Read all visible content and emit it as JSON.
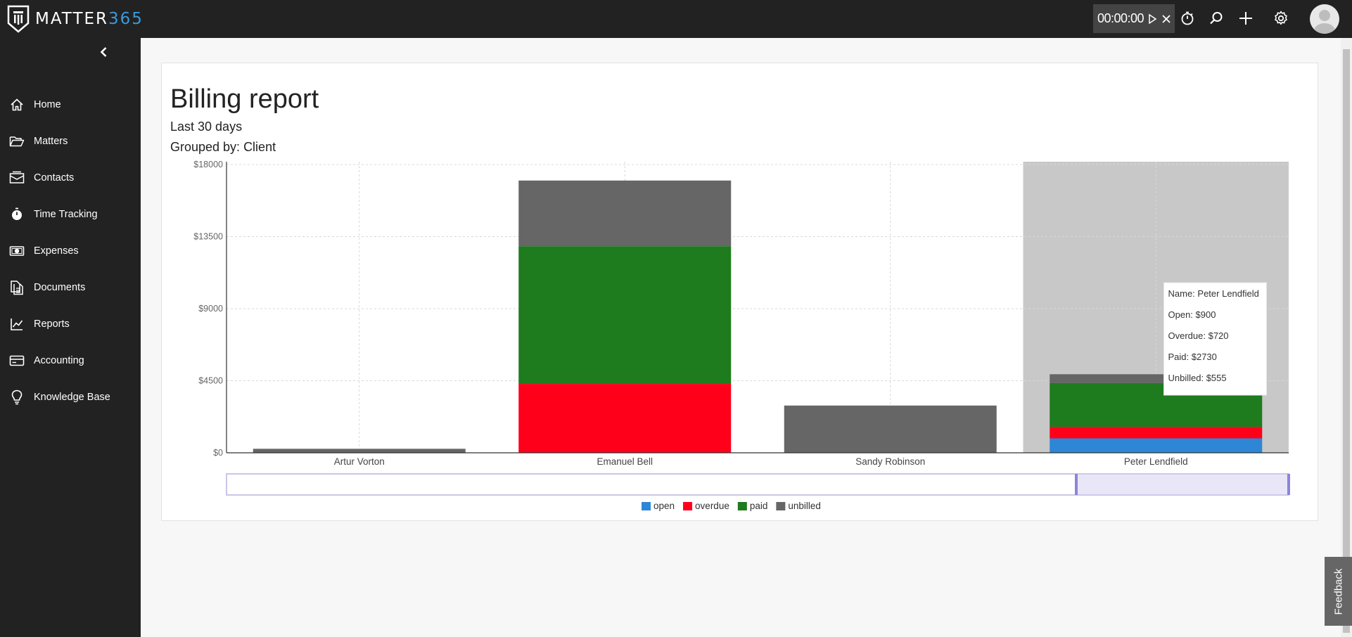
{
  "app": {
    "logo_prefix": "MATTER",
    "logo_suffix": "365",
    "timer": "00:00:00"
  },
  "colors": {
    "chrome": "#222222",
    "accent": "#3a9ad9",
    "open": "#2d86d6",
    "overdue": "#ff001b",
    "paid": "#1e7b1e",
    "unbilled": "#666666",
    "highlight": "#c8c8c8"
  },
  "icons": {
    "collapse": "chevron-left-icon",
    "timer_play": "play-icon",
    "timer_close": "close-icon",
    "stopwatch": "stopwatch-icon",
    "search": "search-icon",
    "add": "plus-icon",
    "settings": "gear-icon",
    "avatar": "user-avatar"
  },
  "sidebar": {
    "items": [
      {
        "label": "Home",
        "icon": "home-icon"
      },
      {
        "label": "Matters",
        "icon": "folder-icon"
      },
      {
        "label": "Contacts",
        "icon": "contacts-icon"
      },
      {
        "label": "Time Tracking",
        "icon": "stopwatch-icon"
      },
      {
        "label": "Expenses",
        "icon": "money-icon"
      },
      {
        "label": "Documents",
        "icon": "documents-icon"
      },
      {
        "label": "Reports",
        "icon": "chart-icon"
      },
      {
        "label": "Accounting",
        "icon": "wallet-icon"
      },
      {
        "label": "Knowledge Base",
        "icon": "lightbulb-icon"
      }
    ]
  },
  "report": {
    "title": "Billing report",
    "period": "Last 30 days",
    "grouping": "Grouped by: Client"
  },
  "feedback_label": "Feedback",
  "chart_data": {
    "type": "bar",
    "stacked": true,
    "categories": [
      "Artur Vorton",
      "Emanuel Bell",
      "Sandy Robinson",
      "Peter Lendfield"
    ],
    "series": [
      {
        "name": "open",
        "values": [
          0,
          0,
          0,
          900
        ]
      },
      {
        "name": "overdue",
        "values": [
          0,
          4300,
          0,
          720
        ]
      },
      {
        "name": "paid",
        "values": [
          0,
          8600,
          0,
          2730
        ]
      },
      {
        "name": "unbilled",
        "values": [
          250,
          4100,
          2950,
          555
        ]
      }
    ],
    "y_ticks": [
      "$0",
      "$4500",
      "$9000",
      "$13500",
      "$18000"
    ],
    "ylim": [
      0,
      18000
    ],
    "grid": true,
    "legend_position": "bottom",
    "highlighted_category": "Peter Lendfield",
    "tooltip": [
      "Name: Peter Lendfield",
      "Open: $900",
      "Overdue: $720",
      "Paid: $2730",
      "Unbilled: $555"
    ],
    "brush_range": [
      0.8,
      1.0
    ]
  }
}
